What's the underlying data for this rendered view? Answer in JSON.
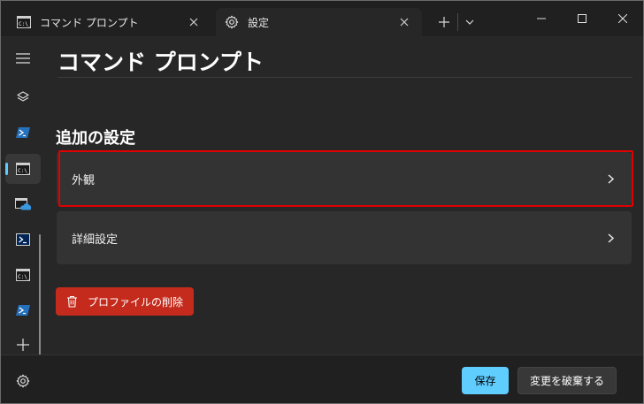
{
  "colors": {
    "accent": "#60cdff",
    "danger": "#c42b1c",
    "highlight": "#e00000"
  },
  "tabs": [
    {
      "label": "コマンド プロンプト",
      "icon": "cmd-icon"
    },
    {
      "label": "設定",
      "icon": "gear-icon"
    }
  ],
  "titlebar": {
    "new_tab_icon": "plus-icon",
    "dropdown_icon": "chevron-down-icon"
  },
  "sidebar": {
    "items": [
      {
        "icon": "hamburger-menu-icon"
      },
      {
        "icon": "layers-icon"
      },
      {
        "icon": "powershell-icon"
      },
      {
        "icon": "cmd-icon",
        "selected": true
      },
      {
        "icon": "azure-cloud-shell-icon"
      },
      {
        "icon": "powershell-icon"
      },
      {
        "icon": "cmd-icon"
      },
      {
        "icon": "powershell-icon"
      },
      {
        "icon": "plus-icon"
      }
    ]
  },
  "main": {
    "title": "コマンド プロンプト",
    "section_title": "追加の設定",
    "rows": [
      {
        "label": "外観"
      },
      {
        "label": "詳細設定"
      }
    ],
    "delete_label": "プロファイルの削除"
  },
  "footer": {
    "save_label": "保存",
    "discard_label": "変更を破棄する"
  }
}
